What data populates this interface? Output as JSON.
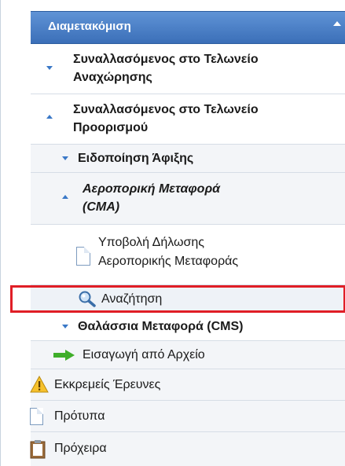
{
  "menu": {
    "header": "Διαμετακόμιση",
    "items": [
      {
        "label_1": "Συναλλασόμενος στο Τελωνείο",
        "label_2": "Αναχώρησης"
      },
      {
        "label_1": "Συναλλασόμενος στο Τελωνείο",
        "label_2": "Προορισμού"
      },
      {
        "label": "Ειδοποίηση Άφιξης"
      },
      {
        "label_1": "Αεροπορική Μεταφορά",
        "label_2": "(CMA)"
      },
      {
        "label_1": "Υποβολή Δήλωσης",
        "label_2": "Αεροπορικής Μεταφοράς"
      },
      {
        "label": "Αναζήτηση"
      },
      {
        "label": "Θαλάσσια Μεταφορά (CMS)"
      },
      {
        "label": "Εισαγωγή από Αρχείο"
      },
      {
        "label": "Εκκρεμείς Έρευνες"
      },
      {
        "label": "Πρότυπα"
      },
      {
        "label": "Πρόχειρα"
      }
    ]
  },
  "icons": {
    "expand": "chevron-down-icon",
    "collapse": "chevron-up-icon",
    "document": "document-icon",
    "search": "magnifier-icon",
    "import": "green-arrow-icon",
    "pending": "warning-icon",
    "templates": "document-icon",
    "drafts": "clipboard-icon"
  },
  "colors": {
    "header": "#3b6fb8",
    "highlight": "#e01e26",
    "accent": "#3a78c7"
  }
}
